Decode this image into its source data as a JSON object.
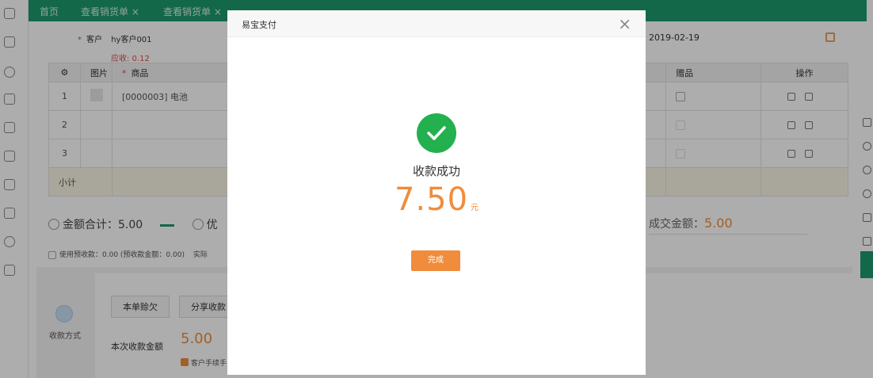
{
  "tabs": [
    {
      "label": "首页"
    },
    {
      "label": "查看销货单 ×"
    },
    {
      "label": "查看销货单 ×"
    }
  ],
  "form": {
    "customer_label": "客户",
    "customer_value": "hy客户001",
    "receivable_text": "应收: 0.12",
    "date": "2019-02-19"
  },
  "table": {
    "headers": [
      "图片",
      "商品",
      "赠品",
      "操作"
    ],
    "rows": [
      {
        "index": "1",
        "product": "[0000003] 电池"
      },
      {
        "index": "2",
        "product": ""
      },
      {
        "index": "3",
        "product": ""
      }
    ],
    "subtotal_label": "小计"
  },
  "summary": {
    "total_label": "金额合计：5.00",
    "discount_prefix": "优",
    "deal_label": "成交金额：",
    "deal_value": "5.00"
  },
  "prepaid": {
    "text": "使用预收款：0.00 (预收款金额：0.00)",
    "suffix": "实际"
  },
  "payment": {
    "btn_owe": "本单赊欠",
    "btn_share": "分享收款",
    "method_label": "收款方式",
    "amount_label": "本次收款金额",
    "amount_value": "5.00",
    "checkbox_label": "客户手续手"
  },
  "modal": {
    "title": "易宝支付",
    "close_glyph": "×",
    "message": "收款成功",
    "amount": "7.50",
    "unit": "元",
    "done_label": "完成"
  },
  "colors": {
    "brand_green": "#1d9a6c",
    "success_green": "#23b04f",
    "accent_orange": "#f08c3b"
  }
}
